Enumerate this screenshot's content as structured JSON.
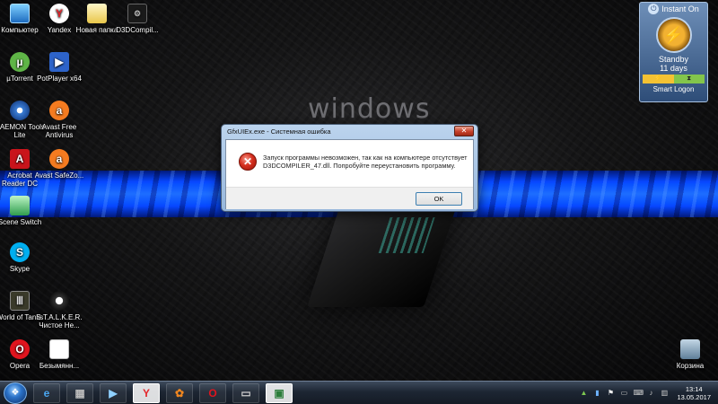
{
  "desktop": {
    "wallpaper_text": "windows",
    "icons": [
      {
        "label": "Компьютер",
        "icon": "computer-icon"
      },
      {
        "label": "Yandex",
        "icon": "yandex-icon"
      },
      {
        "label": "Новая папка",
        "icon": "folder-icon"
      },
      {
        "label": "D3DCompil...",
        "icon": "d3dcompiler-icon"
      },
      {
        "label": "µTorrent",
        "icon": "utorrent-icon"
      },
      {
        "label": "PotPlayer x64",
        "icon": "potplayer-icon"
      },
      {
        "label": "DAEMON Tools Lite",
        "icon": "daemon-tools-icon"
      },
      {
        "label": "Avast Free Antivirus",
        "icon": "avast-icon"
      },
      {
        "label": "Acrobat Reader DC",
        "icon": "acrobat-icon"
      },
      {
        "label": "Avast SafeZo...",
        "icon": "avast-safezone-icon"
      },
      {
        "label": "Scene Switch",
        "icon": "scene-switch-icon"
      },
      {
        "label": "Skype",
        "icon": "skype-icon"
      },
      {
        "label": "World of Tanks",
        "icon": "world-of-tanks-icon"
      },
      {
        "label": "S.T.A.L.K.E.R. Чистое Не...",
        "icon": "stalker-icon"
      },
      {
        "label": "Opera",
        "icon": "opera-icon"
      },
      {
        "label": "Безымянн...",
        "icon": "blank-file-icon"
      },
      {
        "label": "Корзина",
        "icon": "recycle-bin-icon"
      }
    ]
  },
  "gadget": {
    "title": "Instant On",
    "state": "Standby",
    "days_value": "11",
    "days_unit": "days",
    "footer": "Smart Logon",
    "colors": {
      "battery": "#f4c233",
      "hourglass": "#83c54b"
    }
  },
  "dialog": {
    "title": "GfxUIEx.exe - Системная ошибка",
    "close_glyph": "✕",
    "message": "Запуск программы невозможен, так как на компьютере отсутствует D3DCOMPILER_47.dll. Попробуйте переустановить программу.",
    "ok_label": "OK",
    "error_color": "#d6301f"
  },
  "taskbar": {
    "buttons": [
      {
        "icon": "internet-explorer-icon"
      },
      {
        "icon": "film-icon"
      },
      {
        "icon": "media-player-icon"
      },
      {
        "icon": "yandex-browser-icon"
      },
      {
        "icon": "media-dots-icon"
      },
      {
        "icon": "opera-icon"
      },
      {
        "icon": "gpu-tool-icon"
      },
      {
        "icon": "window-app-icon"
      }
    ],
    "clock": {
      "time": "13:14",
      "date": "13.05.2017"
    }
  }
}
